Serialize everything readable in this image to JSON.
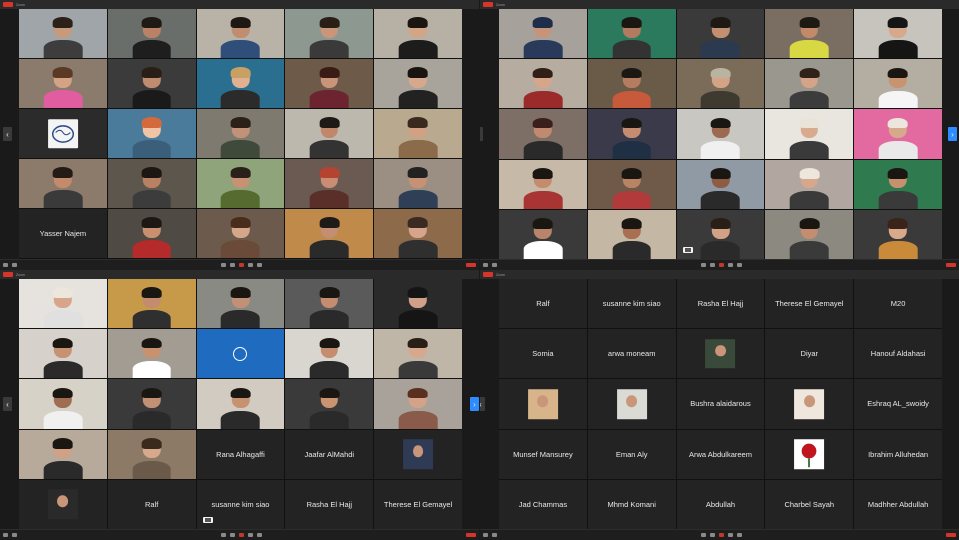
{
  "windows": {
    "tl": {
      "title": "Zoom",
      "tiles": [
        {
          "name": "",
          "kind": "video",
          "skin": "#c79a7c",
          "hair": "#2b2118",
          "shirt": "#3d3d3d",
          "bg": "#9fa5a8"
        },
        {
          "name": "",
          "kind": "video",
          "skin": "#b98266",
          "hair": "#1f1a16",
          "shirt": "#1e1e1e",
          "bg": "#6a6e6a"
        },
        {
          "name": "",
          "kind": "video",
          "skin": "#c08d70",
          "hair": "#1d1814",
          "shirt": "#2f4f7a",
          "bg": "#b9b2a6"
        },
        {
          "name": "",
          "kind": "video",
          "skin": "#c9967a",
          "hair": "#2a1f17",
          "shirt": "#3a3a3a",
          "bg": "#8d9990"
        },
        {
          "name": "",
          "kind": "video",
          "skin": "#d4a486",
          "hair": "#1a1511",
          "shirt": "#1c1c1c",
          "bg": "#b7b1a5"
        },
        {
          "name": "",
          "kind": "video",
          "skin": "#d3a385",
          "hair": "#5a3a24",
          "shirt": "#e05da0",
          "bg": "#8a7b6c"
        },
        {
          "name": "",
          "kind": "video",
          "skin": "#c08c70",
          "hair": "#2a1f17",
          "shirt": "#1a1a1a",
          "bg": "#3b3b3b"
        },
        {
          "name": "",
          "kind": "video",
          "skin": "#e1b091",
          "hair": "#c9a063",
          "shirt": "#2b2b2b",
          "bg": "#2a6f8f"
        },
        {
          "name": "",
          "kind": "video",
          "skin": "#c8947a",
          "hair": "#3a1c14",
          "shirt": "#6b2430",
          "bg": "#6d5a48"
        },
        {
          "name": "",
          "kind": "video",
          "skin": "#d6a98d",
          "hair": "#1a1411",
          "shirt": "#222222",
          "bg": "#a9a49b"
        },
        {
          "name": "",
          "kind": "logo",
          "bg": "#2b2b2b"
        },
        {
          "name": "",
          "kind": "video",
          "skin": "#f0c4a4",
          "hair": "#d46a3b",
          "shirt": "#3b5f7a",
          "bg": "#4a7b9a"
        },
        {
          "name": "",
          "kind": "video",
          "skin": "#c19277",
          "hair": "#2b211a",
          "shirt": "#3f4a3a",
          "bg": "#7e7a70"
        },
        {
          "name": "",
          "kind": "video",
          "skin": "#c0876a",
          "hair": "#1e1a16",
          "shirt": "#333333",
          "bg": "#bdb8ad"
        },
        {
          "name": "",
          "kind": "video",
          "skin": "#d2a184",
          "hair": "#3a2a1d",
          "shirt": "#8b6b4a",
          "bg": "#b9a98e"
        },
        {
          "name": "",
          "kind": "video",
          "skin": "#c38b6b",
          "hair": "#231b15",
          "shirt": "#3a3a3a",
          "bg": "#8c7b6a"
        },
        {
          "name": "",
          "kind": "video",
          "skin": "#b98163",
          "hair": "#1c1713",
          "shirt": "#3c3c3c",
          "bg": "#5c564c"
        },
        {
          "name": "",
          "kind": "video",
          "skin": "#c69273",
          "hair": "#2a201a",
          "shirt": "#556b2f",
          "bg": "#8fa47a"
        },
        {
          "name": "",
          "kind": "video",
          "skin": "#c88d72",
          "hair": "#b4442f",
          "shirt": "#5a2f2a",
          "bg": "#6b5a52"
        },
        {
          "name": "",
          "kind": "video",
          "skin": "#c79273",
          "hair": "#222",
          "shirt": "#2f3f55",
          "bg": "#9b8f84"
        },
        {
          "name": "Yasser Najem",
          "kind": "name"
        },
        {
          "name": "",
          "kind": "video",
          "skin": "#c8906f",
          "hair": "#1c1814",
          "shirt": "#b52a2a",
          "bg": "#4f4a44"
        },
        {
          "name": "",
          "kind": "video",
          "skin": "#d6a68a",
          "hair": "#4a2c1c",
          "shirt": "#6a4b3a",
          "bg": "#6c5b4c"
        },
        {
          "name": "",
          "kind": "video",
          "skin": "#c38e72",
          "hair": "#1e1a17",
          "shirt": "#2a2a2a",
          "bg": "#c08a4a"
        },
        {
          "name": "",
          "kind": "video",
          "skin": "#d6a48a",
          "hair": "#3b2a22",
          "shirt": "#2f2f2f",
          "bg": "#8c6a4a"
        },
        {
          "name": "",
          "kind": "video",
          "skin": "#d8ab8e",
          "hair": "#3a2a1d",
          "shirt": "#3a3a3a",
          "bg": "#b1a99c"
        }
      ]
    },
    "tr": {
      "title": "Zoom",
      "tiles": [
        {
          "name": "",
          "kind": "video",
          "skin": "#c6947a",
          "hair": "#1d2d4a",
          "shirt": "#2a3a5a",
          "bg": "#a6a19a"
        },
        {
          "name": "",
          "kind": "video",
          "skin": "#b07b5e",
          "hair": "#1a1612",
          "shirt": "#333",
          "bg": "#2c7a5e"
        },
        {
          "name": "",
          "kind": "video",
          "skin": "#c28f72",
          "hair": "#1f1914",
          "shirt": "#2b3a4f",
          "bg": "#3a3a3a"
        },
        {
          "name": "",
          "kind": "video",
          "skin": "#c38a6a",
          "hair": "#1f1914",
          "shirt": "#d8d844",
          "bg": "#7a6e62"
        },
        {
          "name": "",
          "kind": "video",
          "skin": "#d6a88c",
          "hair": "#151515",
          "shirt": "#151515",
          "bg": "#c7c4bd"
        },
        {
          "name": "",
          "kind": "video",
          "skin": "#d6a68b",
          "hair": "#2f1f16",
          "shirt": "#9b2b2b",
          "bg": "#b7aca0"
        },
        {
          "name": "",
          "kind": "video",
          "skin": "#b67c5f",
          "hair": "#1c1713",
          "shirt": "#c75a3a",
          "bg": "#6a5a48"
        },
        {
          "name": "",
          "kind": "video",
          "skin": "#d4a386",
          "hair": "#b9b4a0",
          "shirt": "#3e3a30",
          "bg": "#7b6c5a"
        },
        {
          "name": "",
          "kind": "video",
          "skin": "#d5a488",
          "hair": "#2f2219",
          "shirt": "#3c3c3c",
          "bg": "#9a978e"
        },
        {
          "name": "",
          "kind": "video",
          "skin": "#c7946f",
          "hair": "#1a1612",
          "shirt": "#f5f5f5",
          "bg": "#b4ada2"
        },
        {
          "name": "",
          "kind": "video",
          "skin": "#c08a70",
          "hair": "#3a2019",
          "shirt": "#2a2a2a",
          "bg": "#7d6f65"
        },
        {
          "name": "",
          "kind": "video",
          "skin": "#c48d70",
          "hair": "#1a1612",
          "shirt": "#1f2f44",
          "bg": "#3a3a4a"
        },
        {
          "name": "",
          "kind": "video",
          "skin": "#9b6a50",
          "hair": "#1a1612",
          "shirt": "#f0f0f0",
          "bg": "#c9c7c2"
        },
        {
          "name": "",
          "kind": "video",
          "skin": "#d8ab8e",
          "hair": "#eae3d8",
          "shirt": "#3a3a3a",
          "bg": "#e9e5df"
        },
        {
          "name": "",
          "kind": "video",
          "skin": "#d7a98c",
          "hair": "#ece6dc",
          "shirt": "#e9e9e9",
          "bg": "#e36aa0"
        },
        {
          "name": "",
          "kind": "video",
          "skin": "#c48c6d",
          "hair": "#1a1612",
          "shirt": "#a83434",
          "bg": "#c6b9a8"
        },
        {
          "name": "",
          "kind": "video",
          "skin": "#b98463",
          "hair": "#1a1612",
          "shirt": "#b23a3a",
          "bg": "#6f5a4a"
        },
        {
          "name": "",
          "kind": "video",
          "skin": "#8e5c42",
          "hair": "#1a1612",
          "shirt": "#2a2a2a",
          "bg": "#8f9aa4"
        },
        {
          "name": "",
          "kind": "video",
          "skin": "#d6a78b",
          "hair": "#ece6dc",
          "shirt": "#3a3a3a",
          "bg": "#b1a7a0"
        },
        {
          "name": "",
          "kind": "video",
          "skin": "#c6916f",
          "hair": "#1a1612",
          "shirt": "#3a3a3a",
          "bg": "#2f7a4e"
        },
        {
          "name": "",
          "kind": "video",
          "skin": "#b9856a",
          "hair": "#1a1612",
          "shirt": "#ffffff",
          "bg": "#3a3a3a"
        },
        {
          "name": "",
          "kind": "video",
          "skin": "#a86f50",
          "hair": "#1a1612",
          "shirt": "#2a2a2a",
          "bg": "#c4b7a4"
        },
        {
          "name": "",
          "kind": "video",
          "skin": "#d2a186",
          "hair": "#2a1f17",
          "shirt": "#2a2a2a",
          "bg": "#3a3a3a"
        },
        {
          "name": "",
          "kind": "video",
          "skin": "#c38d70",
          "hair": "#1a1612",
          "shirt": "#3a3a3a",
          "bg": "#8c8a80"
        },
        {
          "name": "",
          "kind": "video",
          "skin": "#d8a98a",
          "hair": "#3a241a",
          "shirt": "#c98a3a",
          "bg": "#3a3a3a"
        }
      ]
    },
    "bl": {
      "title": "Zoom",
      "tiles": [
        {
          "name": "",
          "kind": "video",
          "skin": "#d6a58a",
          "hair": "#ece6dc",
          "shirt": "#e0e0e0",
          "bg": "#e6e3de"
        },
        {
          "name": "",
          "kind": "video",
          "skin": "#c48b6e",
          "hair": "#1a1612",
          "shirt": "#2f2f2f",
          "bg": "#c79a4a"
        },
        {
          "name": "",
          "kind": "video",
          "skin": "#c29075",
          "hair": "#1a1612",
          "shirt": "#2a2a2a",
          "bg": "#8a8a84"
        },
        {
          "name": "",
          "kind": "video",
          "skin": "#c58d70",
          "hair": "#1a1612",
          "shirt": "#2a2a2a",
          "bg": "#5a5a5a"
        },
        {
          "name": "",
          "kind": "video",
          "skin": "#d0a088",
          "hair": "#151515",
          "shirt": "#151515",
          "bg": "#2a2a2a"
        },
        {
          "name": "",
          "kind": "video",
          "skin": "#c69272",
          "hair": "#1a1612",
          "shirt": "#2a2a2a",
          "bg": "#d6d2cb"
        },
        {
          "name": "",
          "kind": "video",
          "skin": "#c9926f",
          "hair": "#1a1612",
          "shirt": "#ffffff",
          "bg": "#a29c92"
        },
        {
          "name": "",
          "kind": "wfp",
          "bg": "#1f6bbf"
        },
        {
          "name": "",
          "kind": "video",
          "skin": "#c48d70",
          "hair": "#1a1612",
          "shirt": "#2a2a2a",
          "bg": "#d9d6d0"
        },
        {
          "name": "",
          "kind": "video",
          "skin": "#d6a88d",
          "hair": "#2a1f17",
          "shirt": "#3a3a3a",
          "bg": "#c0b6a8"
        },
        {
          "name": "",
          "kind": "video",
          "skin": "#9f6d52",
          "hair": "#1a1612",
          "shirt": "#f0f0f0",
          "bg": "#d7d2c8"
        },
        {
          "name": "",
          "kind": "video",
          "skin": "#c29074",
          "hair": "#1a1612",
          "shirt": "#2a2a2a",
          "bg": "#3a3a3a"
        },
        {
          "name": "",
          "kind": "video",
          "skin": "#c7926f",
          "hair": "#1a1612",
          "shirt": "#2a2a2a",
          "bg": "#d1cbc1"
        },
        {
          "name": "",
          "kind": "video",
          "skin": "#c9946f",
          "hair": "#1a1612",
          "shirt": "#2a2a2a",
          "bg": "#3a3a3a"
        },
        {
          "name": "",
          "kind": "video",
          "skin": "#d4a286",
          "hair": "#5a2f20",
          "shirt": "#8a5a4a",
          "bg": "#a8a29a"
        },
        {
          "name": "",
          "kind": "video",
          "skin": "#d2a084",
          "hair": "#1a1612",
          "shirt": "#2a2a2a",
          "bg": "#b7aa9a"
        },
        {
          "name": "",
          "kind": "video",
          "skin": "#d7a98c",
          "hair": "#3a2a1d",
          "shirt": "#6b5a4a",
          "bg": "#8c7a66"
        },
        {
          "name": "Rana Alhagaffi",
          "kind": "name"
        },
        {
          "name": "Jaafar AlMahdi",
          "kind": "name"
        },
        {
          "name": "",
          "kind": "small",
          "bg": "#2f3a55"
        },
        {
          "name": "",
          "kind": "small",
          "bg": "#2a2a2a"
        },
        {
          "name": "Ralf",
          "kind": "name"
        },
        {
          "name": "susanne kim siao",
          "kind": "name"
        },
        {
          "name": "Rasha El Hajj",
          "kind": "name"
        },
        {
          "name": "Therese El Gemayel",
          "kind": "name"
        }
      ]
    },
    "br": {
      "title": "Zoom",
      "tiles": [
        {
          "name": "Ralf",
          "kind": "name"
        },
        {
          "name": "susanne kim siao",
          "kind": "name"
        },
        {
          "name": "Rasha El Hajj",
          "kind": "name"
        },
        {
          "name": "Therese El Gemayel",
          "kind": "name"
        },
        {
          "name": "M20",
          "kind": "name"
        },
        {
          "name": "Somia",
          "kind": "name"
        },
        {
          "name": "arwa moneam",
          "kind": "name"
        },
        {
          "name": "",
          "kind": "small",
          "bg": "#3a4a3a"
        },
        {
          "name": "Diyar",
          "kind": "name"
        },
        {
          "name": "Hanouf Aldahasi",
          "kind": "name"
        },
        {
          "name": "",
          "kind": "photo",
          "bg": "#d8b48a"
        },
        {
          "name": "",
          "kind": "photo",
          "bg": "#d9dbd4"
        },
        {
          "name": "Bushra alaidarous",
          "kind": "name"
        },
        {
          "name": "",
          "kind": "photo",
          "bg": "#efe7dd"
        },
        {
          "name": "Eshraq AL_swoidy",
          "kind": "name"
        },
        {
          "name": "Munsef Mansurey",
          "kind": "name"
        },
        {
          "name": "Eman Aly",
          "kind": "name"
        },
        {
          "name": "Arwa Abdulkareem",
          "kind": "name"
        },
        {
          "name": "",
          "kind": "rose",
          "bg": "#ffffff"
        },
        {
          "name": "Ibrahim Alluhedan",
          "kind": "name"
        },
        {
          "name": "Jad Chammas",
          "kind": "name"
        },
        {
          "name": "Mhmd Komani",
          "kind": "name"
        },
        {
          "name": "Abdullah",
          "kind": "name"
        },
        {
          "name": "Charbel Sayah",
          "kind": "name"
        },
        {
          "name": "Madhher Abdullah",
          "kind": "name"
        }
      ]
    }
  },
  "colors": {
    "end_button": "#d9342b",
    "page_arrow_active": "#2d8cff"
  }
}
